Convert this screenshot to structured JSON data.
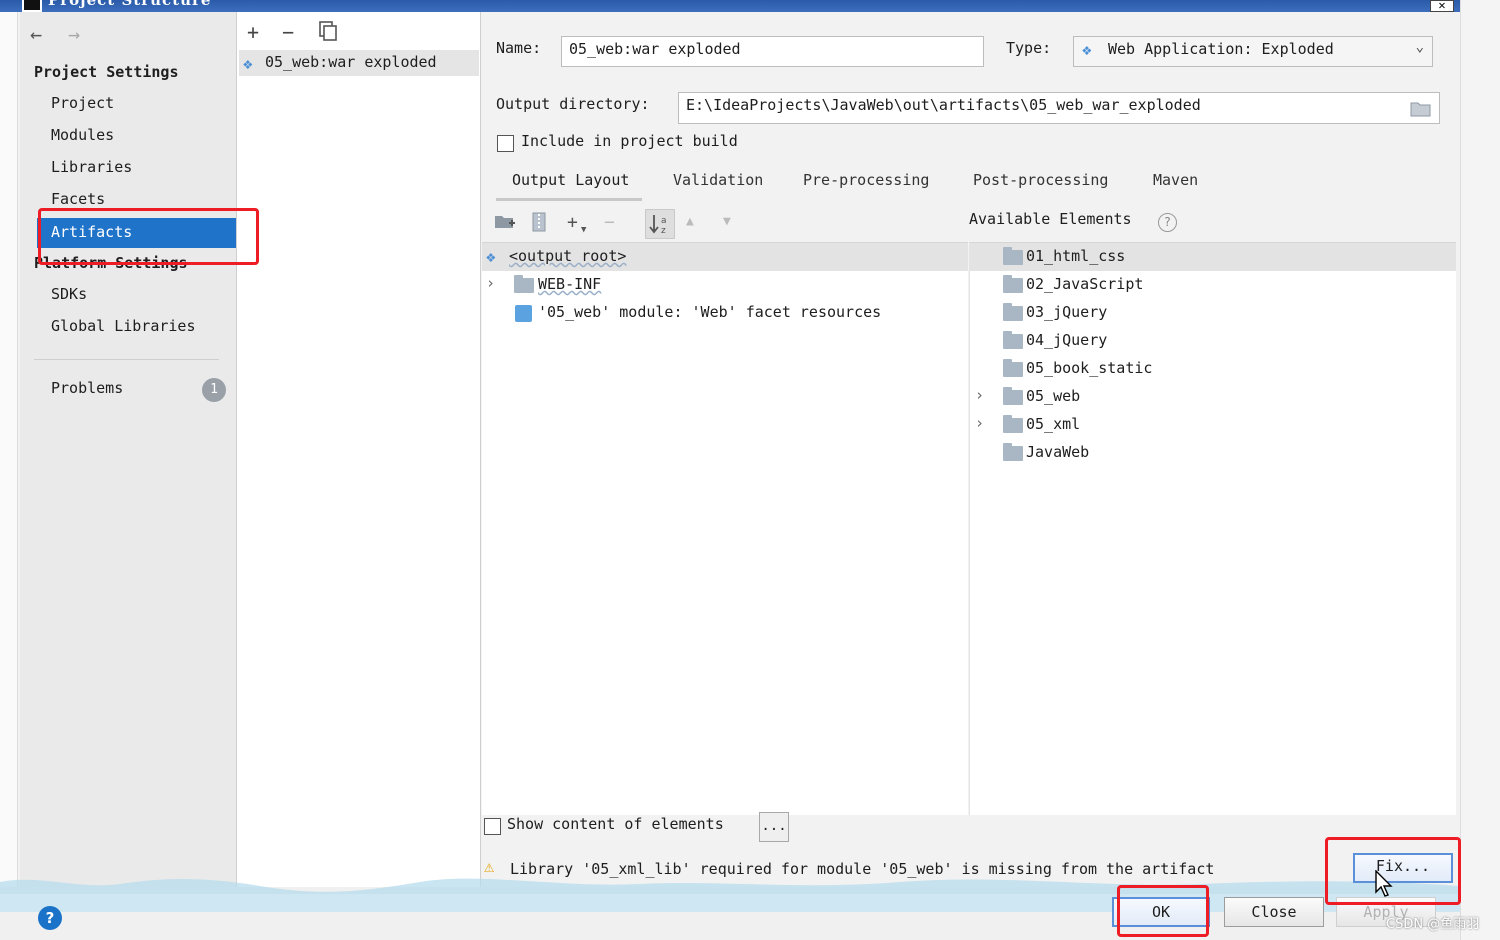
{
  "window": {
    "title": "Project Structure"
  },
  "nav": {
    "back_icon": "arrow-left-icon",
    "forward_icon": "arrow-right-icon",
    "project_settings": "Project Settings",
    "items": [
      "Project",
      "Modules",
      "Libraries",
      "Facets",
      "Artifacts"
    ],
    "platform_settings": "Platform Settings",
    "platform_items": [
      "SDKs",
      "Global Libraries"
    ],
    "problems": "Problems",
    "problems_count": "1"
  },
  "artifacts": {
    "toolbar": {
      "add": "+",
      "remove": "−"
    },
    "items": [
      "05_web:war exploded"
    ]
  },
  "details": {
    "name_label": "Name:",
    "name_value": "05_web:war exploded",
    "type_label": "Type:",
    "type_value": "Web Application: Exploded",
    "output_dir_label": "Output directory:",
    "output_dir_value": "E:\\IdeaProjects\\JavaWeb\\out\\artifacts\\05_web_war_exploded",
    "include_build_label": "Include in project build",
    "tabs": [
      "Output Layout",
      "Validation",
      "Pre-processing",
      "Post-processing",
      "Maven"
    ],
    "available_elements_label": "Available Elements",
    "layout_tree": [
      "<output root>",
      "WEB-INF",
      "'05_web' module: 'Web' facet resources"
    ],
    "available_tree": [
      "01_html_css",
      "02_JavaScript",
      "03_jQuery",
      "04_jQuery",
      "05_book_static",
      "05_web",
      "05_xml",
      "JavaWeb"
    ],
    "show_content_label": "Show content of elements",
    "show_content_btn": "...",
    "warning_text": "Library '05_xml_lib' required for module '05_web' is missing from the artifact",
    "fix_label": "Fix..."
  },
  "buttons": {
    "ok": "OK",
    "close": "Close",
    "apply": "Apply",
    "help": "?"
  },
  "watermark": "CSDN @鱼雨羽",
  "colors": {
    "selection": "#1f73c9",
    "annotation": "#ee1c25",
    "warning": "#e6a000"
  }
}
